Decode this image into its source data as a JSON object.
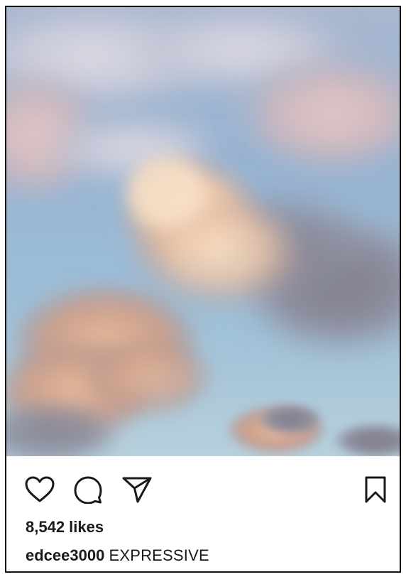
{
  "post": {
    "image_description": "",
    "likes_text": "8,542 likes",
    "username": "edcee3000",
    "caption": "EXPRESSIVE"
  },
  "actions": {
    "like_icon": "heart-icon",
    "comment_icon": "speech-bubble-icon",
    "share_icon": "paper-plane-icon",
    "save_icon": "bookmark-icon"
  },
  "colors": {
    "text": "#1a1a1a",
    "border": "#111111",
    "sky": "#9bb6cf"
  }
}
